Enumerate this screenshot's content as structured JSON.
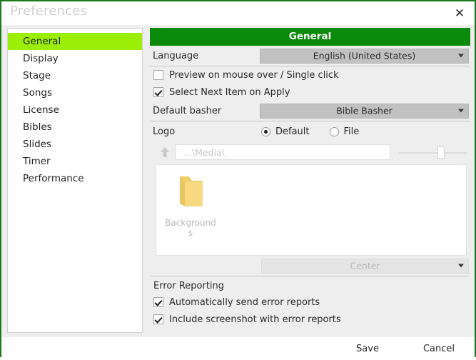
{
  "window": {
    "title": "Preferences",
    "close_label": "✕",
    "border_color": "#1a7a1a"
  },
  "sidebar": {
    "selected_index": 0,
    "highlight_color": "#9bef06",
    "items": [
      {
        "label": "General"
      },
      {
        "label": "Display"
      },
      {
        "label": "Stage"
      },
      {
        "label": "Songs"
      },
      {
        "label": "License"
      },
      {
        "label": "Bibles"
      },
      {
        "label": "Slides"
      },
      {
        "label": "Timer"
      },
      {
        "label": "Performance"
      }
    ]
  },
  "panel": {
    "header": "General",
    "header_color": "#0a8a0a",
    "language": {
      "label": "Language",
      "value": "English (United States)"
    },
    "preview_checkbox": {
      "label": "Preview on mouse over / Single click",
      "checked": false
    },
    "select_next_checkbox": {
      "label": "Select Next Item on Apply",
      "checked": true
    },
    "default_basher": {
      "label": "Default basher",
      "value": "Bible Basher"
    },
    "logo": {
      "label": "Logo",
      "options": [
        {
          "label": "Default",
          "selected": true
        },
        {
          "label": "File",
          "selected": false
        }
      ],
      "path_placeholder": "...\\Media\\",
      "path_value": "...\\Media\\",
      "up_icon": "up-arrow-icon",
      "zoom_slider_percent": 58
    },
    "browser": {
      "files": [
        {
          "name": "Backgrounds",
          "icon": "folder-icon"
        }
      ]
    },
    "alignment": {
      "value": "Center",
      "disabled": true
    },
    "error_reporting": {
      "title": "Error Reporting",
      "auto_send": {
        "label": "Automatically send error reports",
        "checked": true
      },
      "include_screenshot": {
        "label": "Include screenshot with error reports",
        "checked": true
      }
    }
  },
  "footer": {
    "save_label": "Save",
    "cancel_label": "Cancel"
  }
}
